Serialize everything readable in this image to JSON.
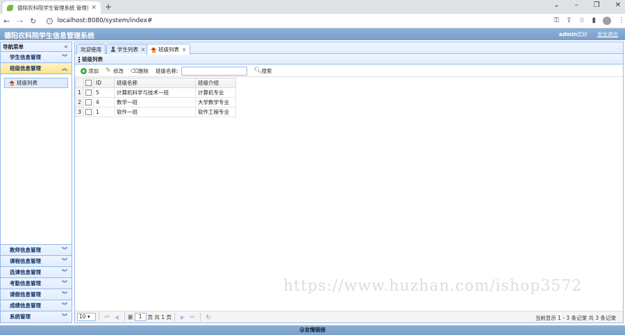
{
  "browser": {
    "tab_title": "德阳农科院学生管理系统 管理员",
    "tab_close": "×",
    "new_tab": "+",
    "url": "localhost:8080/system/index#"
  },
  "header": {
    "brand": "德阳农科院学生信息管理系统",
    "username": "admin",
    "greeting": "您好",
    "logout": "安全退出"
  },
  "sidebar": {
    "title": "导航菜单",
    "sections_top": [
      {
        "label": "学生信息管理"
      },
      {
        "label": "班级信息管理"
      }
    ],
    "active_item": "班级列表",
    "sections_bottom": [
      {
        "label": "教师信息管理"
      },
      {
        "label": "课程信息管理"
      },
      {
        "label": "选课信息管理"
      },
      {
        "label": "考勤信息管理"
      },
      {
        "label": "请假信息管理"
      },
      {
        "label": "成绩信息管理"
      },
      {
        "label": "系统管理"
      }
    ]
  },
  "tabs": [
    {
      "label": "欢迎使用"
    },
    {
      "label": "学生列表"
    },
    {
      "label": "班级列表"
    }
  ],
  "panel": {
    "title": "班级列表"
  },
  "toolbar": {
    "add": "添加",
    "edit": "修改",
    "delete": "删除",
    "search_label": "班级名称:",
    "search_value": "",
    "search_button": "搜索"
  },
  "grid": {
    "columns": [
      "ID",
      "班级名称",
      "班级介绍"
    ],
    "rows": [
      {
        "rownum": "1",
        "id": "5",
        "name": "计算机科学与技术一班",
        "intro": "计算机专业"
      },
      {
        "rownum": "2",
        "id": "4",
        "name": "数学一班",
        "intro": "大学数学专业"
      },
      {
        "rownum": "3",
        "id": "1",
        "name": "软件一班",
        "intro": "软件工程专业"
      }
    ]
  },
  "pager": {
    "page_size": "10",
    "page_prefix": "第",
    "page_number": "1",
    "page_suffix": "页 共 1 页",
    "info": "当前显示 1 - 3 条记录 共 3 条记录"
  },
  "watermark": "https://www.huzhan.com/ishop3572",
  "footer": {
    "text": "@友情链接"
  }
}
